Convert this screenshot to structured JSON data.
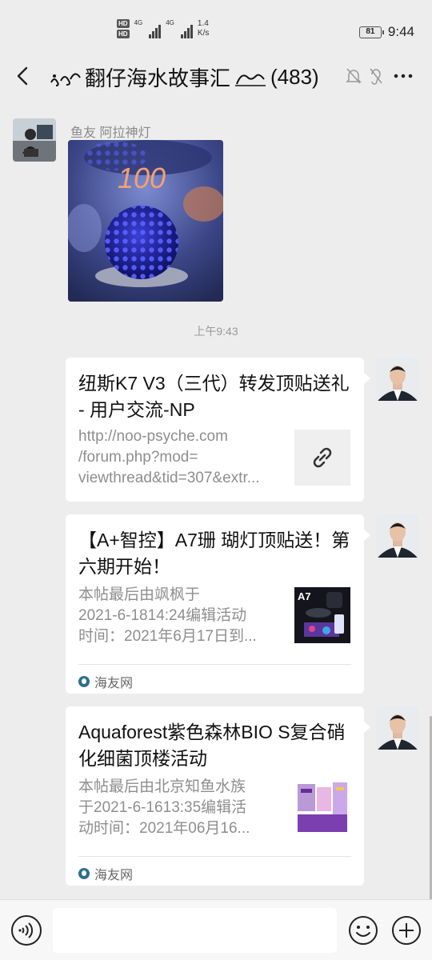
{
  "status_bar": {
    "hd1": "HD",
    "hd2": "HD",
    "net1": "4G",
    "net2": "4G",
    "speed_value": "1.4",
    "speed_unit": "K/s",
    "battery": "81",
    "time": "9:44"
  },
  "header": {
    "title": "翻仔海水故事汇",
    "member_count": "(483)"
  },
  "messages": {
    "first": {
      "sender": "鱼友 阿拉神灯",
      "photo_text": "100"
    },
    "timestamp": "上午9:43",
    "cards": [
      {
        "title": "纽斯K7 V3（三代）转发顶贴送礼 - 用户交流-NP",
        "desc_lines": [
          "http://noo-psyche.com",
          "/forum.php?mod=",
          "viewthread&tid=307&extr..."
        ]
      },
      {
        "title": "【A+智控】A7珊 瑚灯顶贴送！第六期开始！",
        "desc_lines": [
          "本帖最后由飒枫于",
          "2021-6-1814:24编辑活动",
          "时间：2021年6月17日到..."
        ],
        "thumb_label": "A7",
        "source": "海友网"
      },
      {
        "title": "Aquaforest紫色森林BIO S复合硝化细菌顶楼活动",
        "desc_lines": [
          "本帖最后由北京知鱼水族",
          "于2021-6-1613:35编辑活",
          "动时间：2021年06月16..."
        ],
        "source": "海友网"
      }
    ]
  },
  "colors": {
    "background": "#ededed",
    "card": "#ffffff",
    "muted_text": "#8e8e8e"
  }
}
